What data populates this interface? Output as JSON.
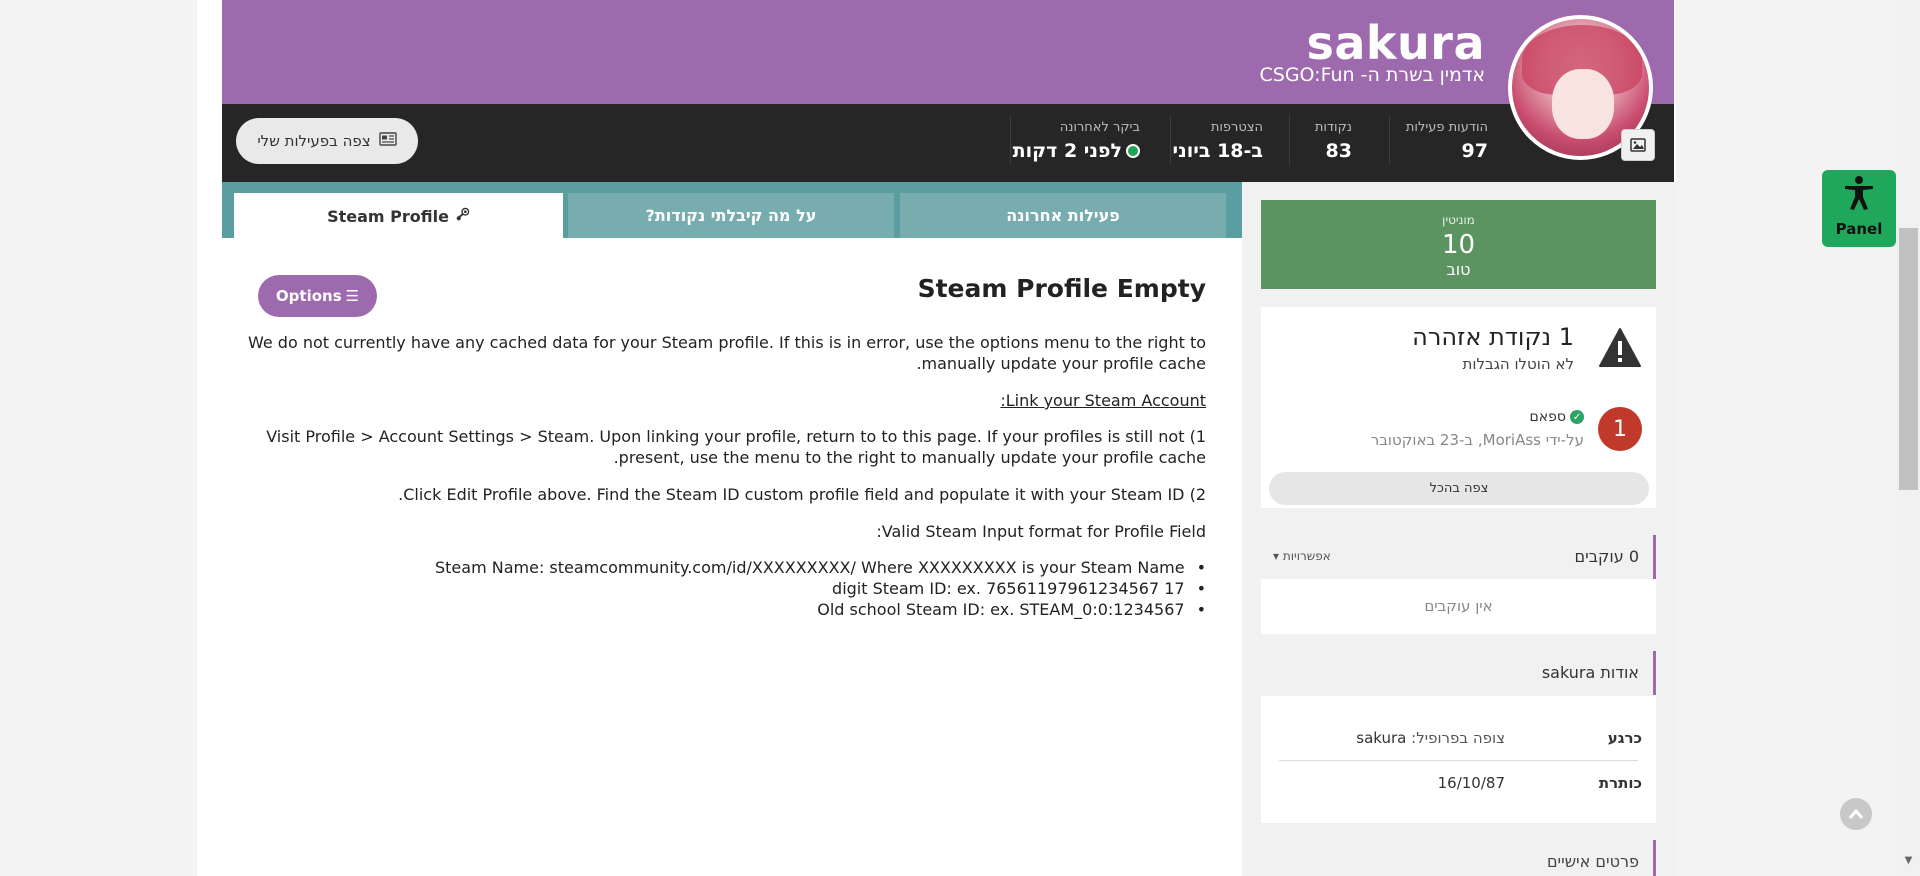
{
  "header": {
    "username": "sakura",
    "user_title": "אדמין בשרת ה- CSGO:Fun",
    "avatar_edit_icon": "image-icon"
  },
  "stats": [
    {
      "label": "הודעות פעילות",
      "value": "97"
    },
    {
      "label": "נקודות",
      "value": "83"
    },
    {
      "label": "הצטרפות",
      "value": "ב-18 ביוני"
    },
    {
      "label": "ביקר לאחרונה",
      "value": "לפני 2 דקות",
      "online_color": "#1ea656"
    }
  ],
  "activity_button": {
    "label": "צפה בפעילות שלי",
    "icon": "newspaper-icon"
  },
  "tabs": [
    {
      "label": "פעילות אחרונה"
    },
    {
      "label": "על מה קיבלתי נקודות?"
    },
    {
      "label": "Steam Profile",
      "icon": "steam-icon",
      "active": true
    }
  ],
  "steam": {
    "title": "Steam Profile Empty",
    "options_label": "Options",
    "options_icon": "menu-icon",
    "line1a": "We do not currently have any cached data for your Steam profile.  If this is in error, use the options menu to the right to",
    "line1b": ".manually update your profile cache",
    "link_heading": ":Link your Steam Account",
    "step1a": "Visit Profile > Account Settings > Steam.  Upon linking your profile, return to to this page.  If your profiles is still not (1",
    "step1b": ".present, use the menu to the right to manually update your profile cache",
    "step2": ".Click Edit Profile above.  Find the Steam ID custom profile field and populate it with your Steam ID (2",
    "format_heading": ":Valid Steam Input format for Profile Field",
    "formats": [
      "Steam Name: steamcommunity.com/id/XXXXXXXXX/  Where XXXXXXXXX is your Steam Name",
      "digit Steam ID: ex. 76561197961234567 17",
      "Old school Steam ID: ex. STEAM_0:0:1234567"
    ]
  },
  "reputation": {
    "label": "מוניטין",
    "value": "10",
    "word": "טוב",
    "color": "#5b9460"
  },
  "warnings": {
    "title": "1 נקודת אזהרה",
    "subtitle": "לא הוטלו הגבלות",
    "badge": "1",
    "reason": "ספאם",
    "by": "על-ידי MoriAss, ב-23 באוקטובר",
    "view_all": "צפה בהכל"
  },
  "followers": {
    "title": "0 עוקבים",
    "options": "אפשרויות",
    "empty": "אין עוקבים"
  },
  "about": {
    "title": "אודות sakura",
    "rows": [
      {
        "key": "כרגע",
        "value_key": "צופה בפרופיל:",
        "value": "sakura"
      },
      {
        "key": "כותרת",
        "value_key": "",
        "value": "16/10/87"
      }
    ]
  },
  "personal": {
    "title": "פרטים אישיים"
  },
  "accessibility": {
    "label": "Panel",
    "icon": "accessibility-icon"
  },
  "colors": {
    "cover": "#9c6aad",
    "tabs": "#5b9ea2",
    "stats_bar": "#262626"
  }
}
